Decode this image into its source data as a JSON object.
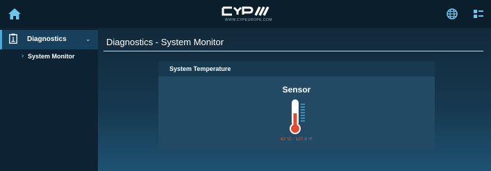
{
  "header": {
    "logo_text": "CYP",
    "logo_url": "WWW.CYPEUROPE.COM"
  },
  "sidebar": {
    "section_label": "Diagnostics",
    "items": [
      {
        "label": "System Monitor"
      }
    ]
  },
  "main": {
    "page_title": "Diagnostics - System Monitor",
    "panel": {
      "header": "System Temperature",
      "sensor_title": "Sensor",
      "reading": "42 °C · 107.6 °F",
      "thermometer_fill_fraction": 0.55
    }
  },
  "icons": {
    "home": "home-icon",
    "globe": "globe-icon",
    "user": "user-menu-icon",
    "clipboard": "clipboard-icon",
    "chevron": "chevron-down-icon",
    "thermometer": "thermometer-icon"
  },
  "colors": {
    "accent": "#4fa8d8",
    "topbar": "#0b1e2b",
    "panel": "#234a64",
    "reading": "#e15a3a",
    "thermometer_fill": "#e04a2e"
  }
}
